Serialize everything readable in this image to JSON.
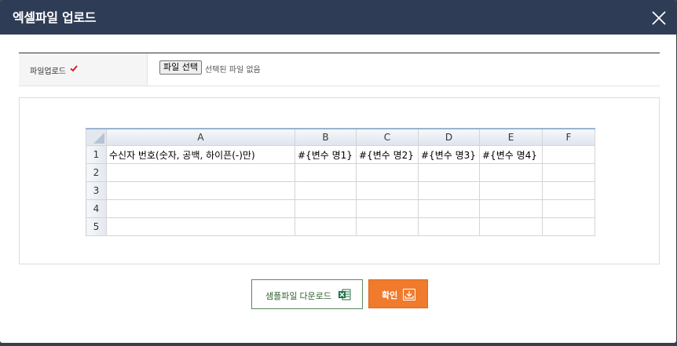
{
  "dialog": {
    "title": "엑셀파일 업로드"
  },
  "upload": {
    "label": "파일업로드",
    "file_button": "파일 선택",
    "file_status": "선택된 파일 없음"
  },
  "sheet": {
    "columns": [
      "A",
      "B",
      "C",
      "D",
      "E",
      "F"
    ],
    "rows": [
      {
        "num": "1",
        "cells": [
          "수신자 번호(숫자, 공백, 하이픈(-)만)",
          "#{변수 명1}",
          "#{변수 명2}",
          "#{변수 명3}",
          "#{변수 명4}",
          ""
        ]
      },
      {
        "num": "2",
        "cells": [
          "",
          "",
          "",
          "",
          "",
          ""
        ]
      },
      {
        "num": "3",
        "cells": [
          "",
          "",
          "",
          "",
          "",
          ""
        ]
      },
      {
        "num": "4",
        "cells": [
          "",
          "",
          "",
          "",
          "",
          ""
        ]
      },
      {
        "num": "5",
        "cells": [
          "",
          "",
          "",
          "",
          "",
          ""
        ]
      }
    ]
  },
  "buttons": {
    "sample_download": "샘플파일 다운로드",
    "confirm": "확인"
  },
  "colors": {
    "title_bar": "#2f3c55",
    "confirm": "#f07b2c",
    "check": "#d0202a"
  }
}
